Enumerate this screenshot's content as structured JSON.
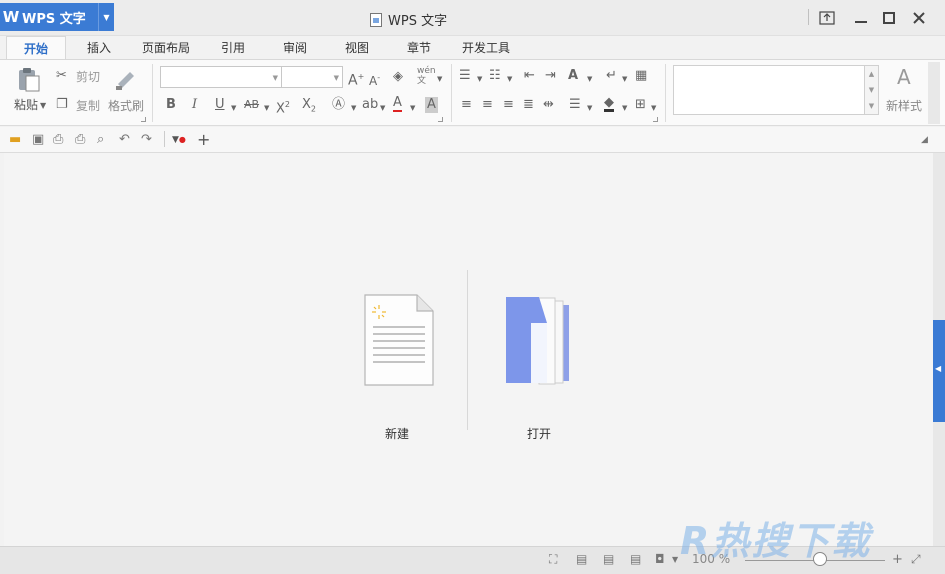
{
  "app": {
    "logo": "W",
    "name": "WPS 文字",
    "window_title": "WPS 文字"
  },
  "window_controls": {
    "restore_icon": "⧉",
    "minimize_icon": "—",
    "maximize_icon": "□",
    "close_icon": "✕"
  },
  "tabs": [
    {
      "label": "开始",
      "active": true
    },
    {
      "label": "插入"
    },
    {
      "label": "页面布局"
    },
    {
      "label": "引用"
    },
    {
      "label": "审阅"
    },
    {
      "label": "视图"
    },
    {
      "label": "章节"
    },
    {
      "label": "开发工具"
    }
  ],
  "ribbon": {
    "paste": "粘贴",
    "cut": "剪切",
    "copy": "复制",
    "format_painter": "格式刷",
    "phonetic": "wén 文",
    "new_style": "新样式"
  },
  "start_page": {
    "new_label": "新建",
    "open_label": "打开"
  },
  "status": {
    "zoom": "100 %"
  },
  "watermark": "R热搜下载",
  "colors": {
    "accent": "#3b7bd4",
    "tab_active": "#2e6fc8"
  }
}
